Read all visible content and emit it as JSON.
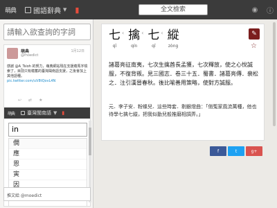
{
  "topbar": {
    "brand": "萌典",
    "dict_label": "國語辭典",
    "search_placeholder": "全文檢索",
    "icons": [
      "bookmark-icon",
      "apple-icon",
      "android-icon",
      "info-icon"
    ]
  },
  "sidebar": {
    "search_placeholder": "請輸入欲查詢的字詞",
    "tweet": {
      "name": "萌典",
      "handle": "@moedict",
      "date": "1月12日",
      "body": "感謝 @A_Tsioh 的努力，萌典網站現在支援蘊馬字檢索了，目前只有蘊蓄的臺灣閩南語支援，之後會加上其他語種。",
      "link": "pic.twitter.com/uV8tQovL4N"
    },
    "mini_bar": {
      "brand": "萌典",
      "dict_label": "臺灣閩南語"
    },
    "input_value": "in",
    "suggestions": [
      "僩",
      "應",
      "恩",
      "寅",
      "因",
      "引"
    ],
    "tweet_to": "推文給 @moedict"
  },
  "entry": {
    "chars": [
      {
        "han": "七",
        "pinyin": "qī"
      },
      {
        "han": "擒",
        "pinyin": "qín"
      },
      {
        "han": "七",
        "pinyin": "qī"
      },
      {
        "han": "縱",
        "pinyin": "zòng"
      }
    ],
    "definition": "諸葛亮征南夷，七次生擒酋長孟獲，七次釋放，使之心悅誠服，不復背叛。見三國志．卷三十五．蜀書．諸葛亮傳．裴松之．注引漢晉春秋。後比喻善用策略，使對方誠服。",
    "example": "元．李子安．粉蝶兒．這些時套．剔銀燈曲：「俏冤家風流萬種，他也待學七擒七縱，把我似動兒般推磨相調弄。」"
  },
  "social": {
    "facebook": "f",
    "twitter": "t",
    "gplus": "g+"
  }
}
